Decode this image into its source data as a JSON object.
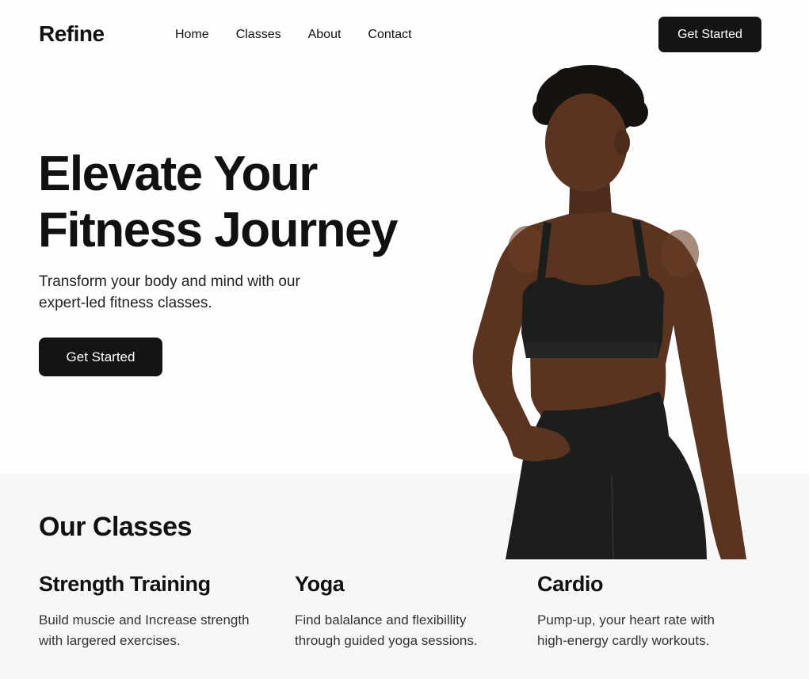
{
  "brand": {
    "logo": "Refine"
  },
  "nav": {
    "items": [
      "Home",
      "Classes",
      "About",
      "Contact"
    ],
    "cta_label": "Get Started"
  },
  "hero": {
    "title_line1": "Elevate Your",
    "title_line2": "Fitness Journey",
    "subtitle_line1": "Transform your body and mind with our",
    "subtitle_line2": "expert-led fitness classes.",
    "cta_label": "Get Started"
  },
  "classes": {
    "title": "Our Classes",
    "items": [
      {
        "name": "Strength Training",
        "desc_line1": "Build muscie and Increase strength",
        "desc_line2": "with largered exercises."
      },
      {
        "name": "Yoga",
        "desc_line1": "Find balalance and flexibillity",
        "desc_line2": "through guided yoga sessions."
      },
      {
        "name": "Cardio",
        "desc_line1": "Pump-up, your heart rate with",
        "desc_line2": "high-energy cardly workouts."
      }
    ]
  },
  "colors": {
    "primary_button": "#141414",
    "text": "#111111",
    "classes_section_bg": "#f7f7f7",
    "skin": "#5a3421",
    "sportswear": "#1c1e1e"
  }
}
